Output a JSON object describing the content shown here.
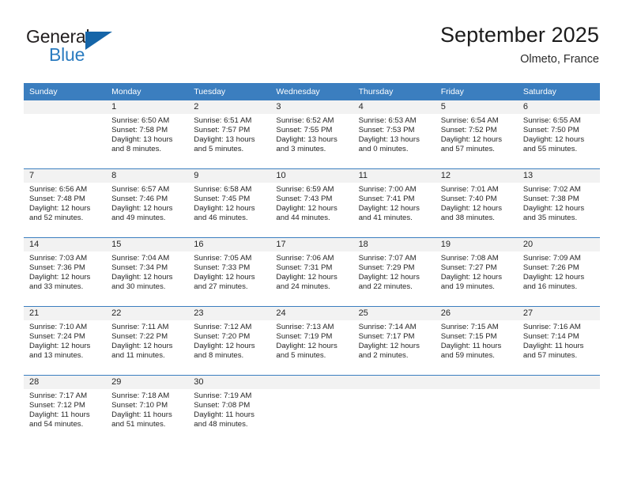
{
  "brand": {
    "name_top": "General",
    "name_bottom": "Blue",
    "accent_color": "#2b7cc0",
    "triangle_color": "#1565a8"
  },
  "header": {
    "title": "September 2025",
    "location": "Olmeto, France"
  },
  "calendar": {
    "header_color": "#3b7ebf",
    "daynum_band_color": "#f2f2f2",
    "weekday_names": [
      "Sunday",
      "Monday",
      "Tuesday",
      "Wednesday",
      "Thursday",
      "Friday",
      "Saturday"
    ],
    "labels": {
      "sunrise": "Sunrise:",
      "sunset": "Sunset:",
      "daylight": "Daylight:"
    },
    "weeks": [
      [
        {
          "day": "",
          "lines": []
        },
        {
          "day": "1",
          "lines": [
            "Sunrise: 6:50 AM",
            "Sunset: 7:58 PM",
            "Daylight: 13 hours",
            "and 8 minutes."
          ]
        },
        {
          "day": "2",
          "lines": [
            "Sunrise: 6:51 AM",
            "Sunset: 7:57 PM",
            "Daylight: 13 hours",
            "and 5 minutes."
          ]
        },
        {
          "day": "3",
          "lines": [
            "Sunrise: 6:52 AM",
            "Sunset: 7:55 PM",
            "Daylight: 13 hours",
            "and 3 minutes."
          ]
        },
        {
          "day": "4",
          "lines": [
            "Sunrise: 6:53 AM",
            "Sunset: 7:53 PM",
            "Daylight: 13 hours",
            "and 0 minutes."
          ]
        },
        {
          "day": "5",
          "lines": [
            "Sunrise: 6:54 AM",
            "Sunset: 7:52 PM",
            "Daylight: 12 hours",
            "and 57 minutes."
          ]
        },
        {
          "day": "6",
          "lines": [
            "Sunrise: 6:55 AM",
            "Sunset: 7:50 PM",
            "Daylight: 12 hours",
            "and 55 minutes."
          ]
        }
      ],
      [
        {
          "day": "7",
          "lines": [
            "Sunrise: 6:56 AM",
            "Sunset: 7:48 PM",
            "Daylight: 12 hours",
            "and 52 minutes."
          ]
        },
        {
          "day": "8",
          "lines": [
            "Sunrise: 6:57 AM",
            "Sunset: 7:46 PM",
            "Daylight: 12 hours",
            "and 49 minutes."
          ]
        },
        {
          "day": "9",
          "lines": [
            "Sunrise: 6:58 AM",
            "Sunset: 7:45 PM",
            "Daylight: 12 hours",
            "and 46 minutes."
          ]
        },
        {
          "day": "10",
          "lines": [
            "Sunrise: 6:59 AM",
            "Sunset: 7:43 PM",
            "Daylight: 12 hours",
            "and 44 minutes."
          ]
        },
        {
          "day": "11",
          "lines": [
            "Sunrise: 7:00 AM",
            "Sunset: 7:41 PM",
            "Daylight: 12 hours",
            "and 41 minutes."
          ]
        },
        {
          "day": "12",
          "lines": [
            "Sunrise: 7:01 AM",
            "Sunset: 7:40 PM",
            "Daylight: 12 hours",
            "and 38 minutes."
          ]
        },
        {
          "day": "13",
          "lines": [
            "Sunrise: 7:02 AM",
            "Sunset: 7:38 PM",
            "Daylight: 12 hours",
            "and 35 minutes."
          ]
        }
      ],
      [
        {
          "day": "14",
          "lines": [
            "Sunrise: 7:03 AM",
            "Sunset: 7:36 PM",
            "Daylight: 12 hours",
            "and 33 minutes."
          ]
        },
        {
          "day": "15",
          "lines": [
            "Sunrise: 7:04 AM",
            "Sunset: 7:34 PM",
            "Daylight: 12 hours",
            "and 30 minutes."
          ]
        },
        {
          "day": "16",
          "lines": [
            "Sunrise: 7:05 AM",
            "Sunset: 7:33 PM",
            "Daylight: 12 hours",
            "and 27 minutes."
          ]
        },
        {
          "day": "17",
          "lines": [
            "Sunrise: 7:06 AM",
            "Sunset: 7:31 PM",
            "Daylight: 12 hours",
            "and 24 minutes."
          ]
        },
        {
          "day": "18",
          "lines": [
            "Sunrise: 7:07 AM",
            "Sunset: 7:29 PM",
            "Daylight: 12 hours",
            "and 22 minutes."
          ]
        },
        {
          "day": "19",
          "lines": [
            "Sunrise: 7:08 AM",
            "Sunset: 7:27 PM",
            "Daylight: 12 hours",
            "and 19 minutes."
          ]
        },
        {
          "day": "20",
          "lines": [
            "Sunrise: 7:09 AM",
            "Sunset: 7:26 PM",
            "Daylight: 12 hours",
            "and 16 minutes."
          ]
        }
      ],
      [
        {
          "day": "21",
          "lines": [
            "Sunrise: 7:10 AM",
            "Sunset: 7:24 PM",
            "Daylight: 12 hours",
            "and 13 minutes."
          ]
        },
        {
          "day": "22",
          "lines": [
            "Sunrise: 7:11 AM",
            "Sunset: 7:22 PM",
            "Daylight: 12 hours",
            "and 11 minutes."
          ]
        },
        {
          "day": "23",
          "lines": [
            "Sunrise: 7:12 AM",
            "Sunset: 7:20 PM",
            "Daylight: 12 hours",
            "and 8 minutes."
          ]
        },
        {
          "day": "24",
          "lines": [
            "Sunrise: 7:13 AM",
            "Sunset: 7:19 PM",
            "Daylight: 12 hours",
            "and 5 minutes."
          ]
        },
        {
          "day": "25",
          "lines": [
            "Sunrise: 7:14 AM",
            "Sunset: 7:17 PM",
            "Daylight: 12 hours",
            "and 2 minutes."
          ]
        },
        {
          "day": "26",
          "lines": [
            "Sunrise: 7:15 AM",
            "Sunset: 7:15 PM",
            "Daylight: 11 hours",
            "and 59 minutes."
          ]
        },
        {
          "day": "27",
          "lines": [
            "Sunrise: 7:16 AM",
            "Sunset: 7:14 PM",
            "Daylight: 11 hours",
            "and 57 minutes."
          ]
        }
      ],
      [
        {
          "day": "28",
          "lines": [
            "Sunrise: 7:17 AM",
            "Sunset: 7:12 PM",
            "Daylight: 11 hours",
            "and 54 minutes."
          ]
        },
        {
          "day": "29",
          "lines": [
            "Sunrise: 7:18 AM",
            "Sunset: 7:10 PM",
            "Daylight: 11 hours",
            "and 51 minutes."
          ]
        },
        {
          "day": "30",
          "lines": [
            "Sunrise: 7:19 AM",
            "Sunset: 7:08 PM",
            "Daylight: 11 hours",
            "and 48 minutes."
          ]
        },
        {
          "day": "",
          "lines": []
        },
        {
          "day": "",
          "lines": []
        },
        {
          "day": "",
          "lines": []
        },
        {
          "day": "",
          "lines": []
        }
      ]
    ]
  }
}
